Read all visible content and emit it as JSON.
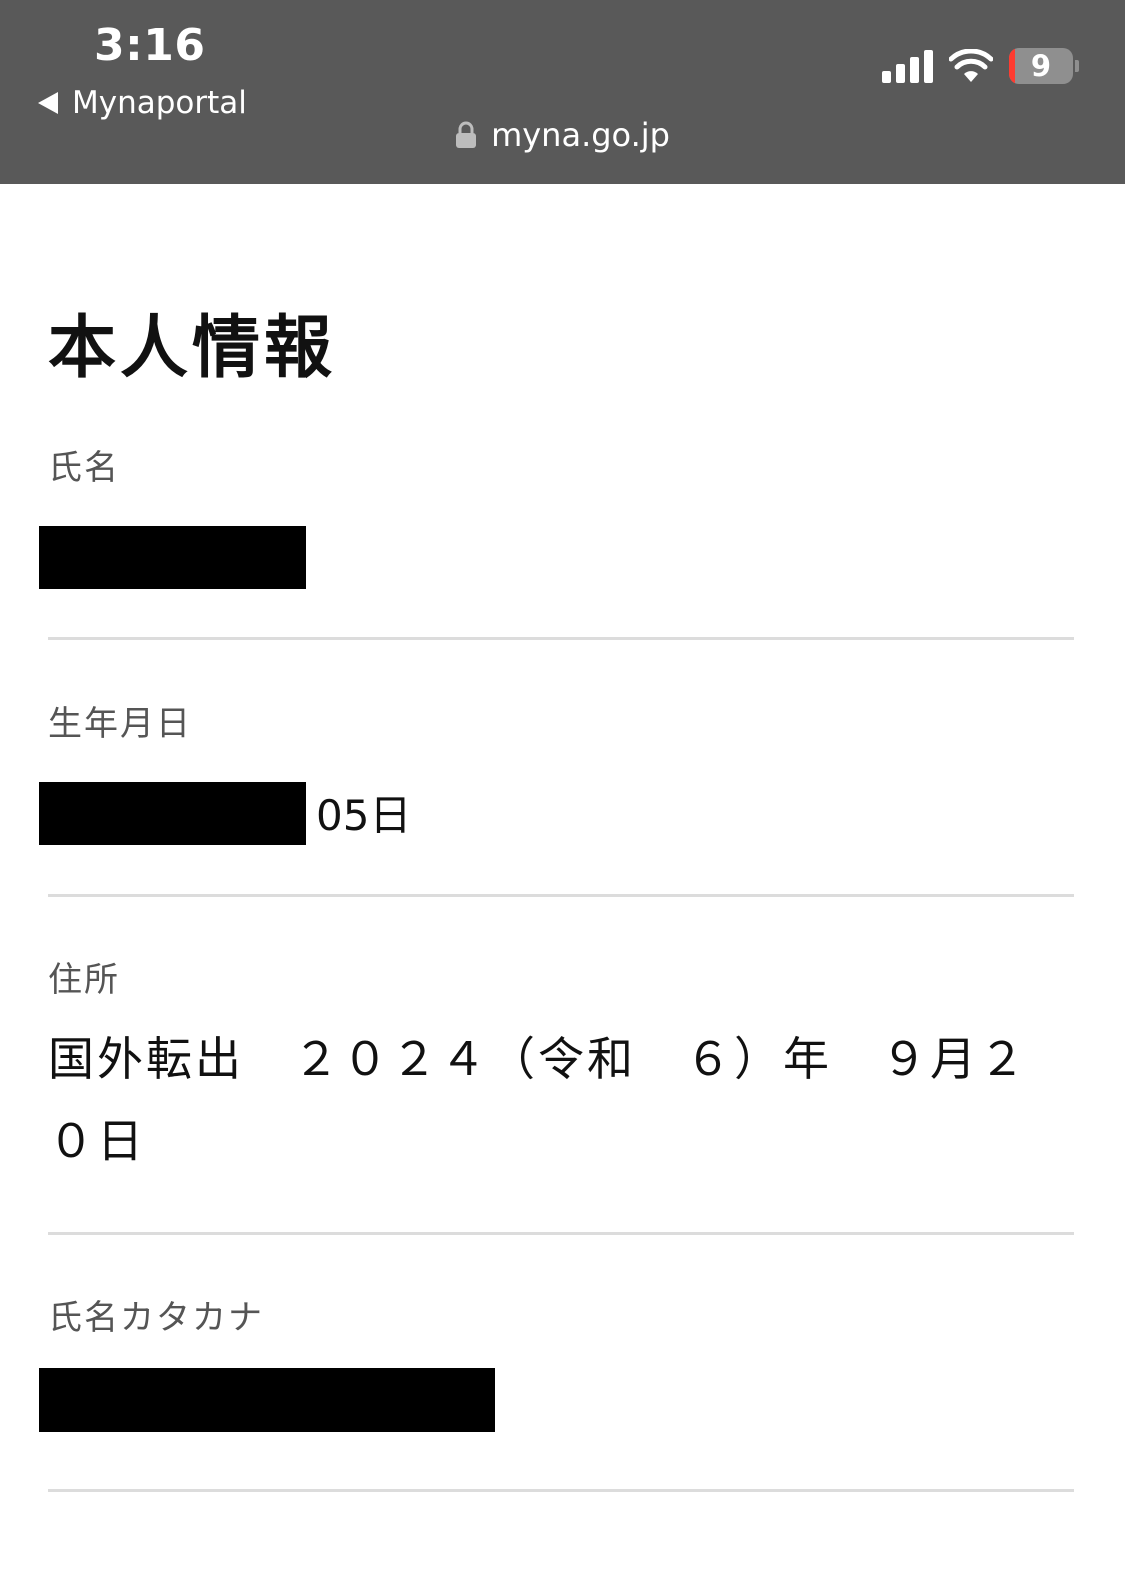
{
  "status_bar": {
    "time": "3:16",
    "back_app": "Mynaportal",
    "battery_level": "9",
    "signal_bars": 4
  },
  "browser": {
    "url": "myna.go.jp"
  },
  "page": {
    "title": "本人情報",
    "fields": {
      "name": {
        "label": "氏名",
        "value_redacted": true
      },
      "birthdate": {
        "label": "生年月日",
        "value_visible_suffix": "05日",
        "value_redacted": true
      },
      "address": {
        "label": "住所",
        "value": "国外転出　２０２４（令和　６）年　９月２０日"
      },
      "name_katakana": {
        "label": "氏名カタカナ",
        "value_redacted": true
      }
    }
  },
  "colors": {
    "chrome_background": "#595959",
    "battery_low": "#ff3b30",
    "redaction": "#000000",
    "divider": "#dcdcdc"
  },
  "icons": [
    "back-arrow-icon",
    "lock-icon",
    "cellular-signal-icon",
    "wifi-icon",
    "battery-icon"
  ]
}
